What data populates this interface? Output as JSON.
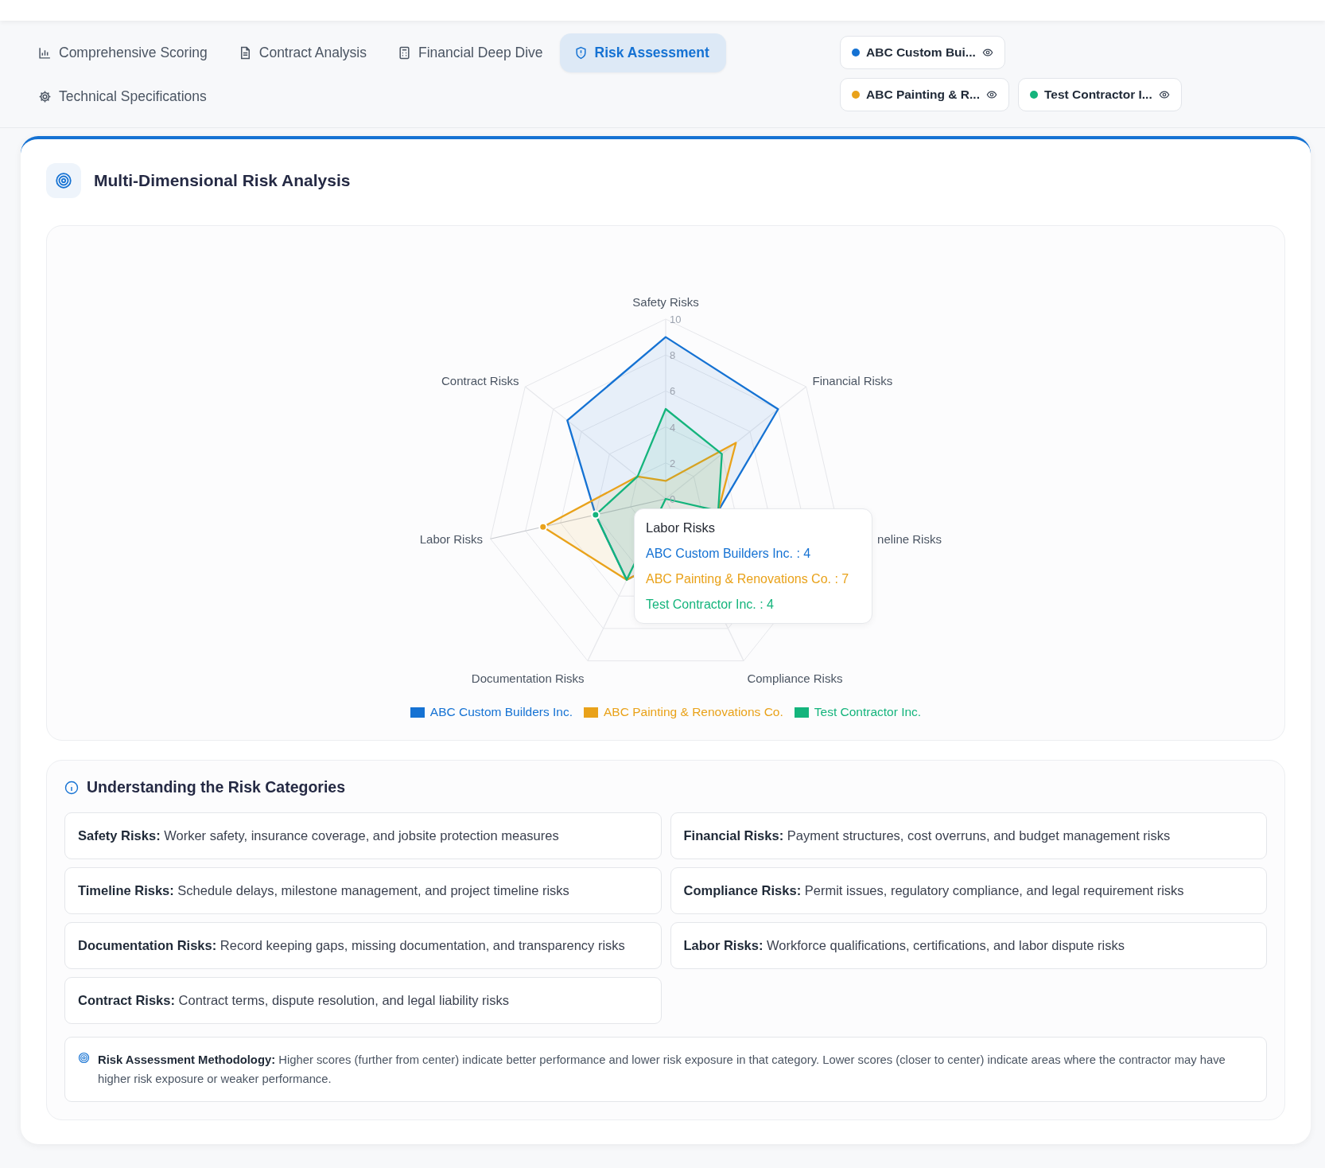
{
  "tabs": [
    {
      "label": "Comprehensive Scoring",
      "selected": false
    },
    {
      "label": "Contract Analysis",
      "selected": false
    },
    {
      "label": "Financial Deep Dive",
      "selected": false
    },
    {
      "label": "Risk Assessment",
      "selected": true
    },
    {
      "label": "Technical Specifications",
      "selected": false
    }
  ],
  "contractors": [
    {
      "name": "ABC Custom Bui...",
      "color": "#1572d3"
    },
    {
      "name": "ABC Painting & R...",
      "color": "#e9a21a"
    },
    {
      "name": "Test Contractor I...",
      "color": "#14b47c"
    }
  ],
  "card": {
    "title": "Multi-Dimensional Risk Analysis",
    "chart_data": {
      "type": "radar",
      "categories": [
        "Safety Risks",
        "Financial Risks",
        "neline Risks",
        "Compliance Risks",
        "Documentation Risks",
        "Labor Risks",
        "Contract Risks"
      ],
      "ylim": [
        0,
        10
      ],
      "yticks": [
        0,
        2,
        4,
        6,
        8,
        10
      ],
      "series": [
        {
          "name": "ABC Custom Builders Inc.",
          "color": "#1572d3",
          "values": [
            9,
            8,
            3,
            3,
            5,
            4,
            7
          ]
        },
        {
          "name": "ABC Painting & Renovations Co.",
          "color": "#e9a21a",
          "values": [
            1,
            5,
            3,
            3,
            5,
            7,
            2
          ]
        },
        {
          "name": "Test Contractor Inc.",
          "color": "#14b47c",
          "values": [
            5,
            4,
            3,
            0,
            5,
            4,
            2
          ]
        }
      ]
    },
    "tooltip": {
      "title": "Labor Risks",
      "lines": [
        {
          "text": "ABC Custom Builders Inc. : 4",
          "color": "#1572d3"
        },
        {
          "text": "ABC Painting & Renovations Co. : 7",
          "color": "#e9a21a"
        },
        {
          "text": "Test Contractor Inc. : 4",
          "color": "#14b47c"
        }
      ]
    }
  },
  "categories_panel": {
    "title": "Understanding the Risk Categories",
    "items": [
      "**Safety Risks:** Worker safety, insurance coverage, and jobsite protection measures",
      "**Financial Risks:** Payment structures, cost overruns, and budget management risks",
      "**Timeline Risks:** Schedule delays, milestone management, and project timeline risks",
      "**Compliance Risks:** Permit issues, regulatory compliance, and legal requirement risks",
      "**Documentation Risks:** Record keeping gaps, missing documentation, and transparency risks",
      "**Labor Risks:** Workforce qualifications, certifications, and labor dispute risks",
      "**Contract Risks:** Contract terms, dispute resolution, and legal liability risks"
    ],
    "methodology": "**Risk Assessment Methodology:** Higher scores (further from center) indicate better performance and lower risk exposure in that category. Lower scores (closer to center) indicate areas where the contractor may have higher risk exposure or weaker performance."
  }
}
